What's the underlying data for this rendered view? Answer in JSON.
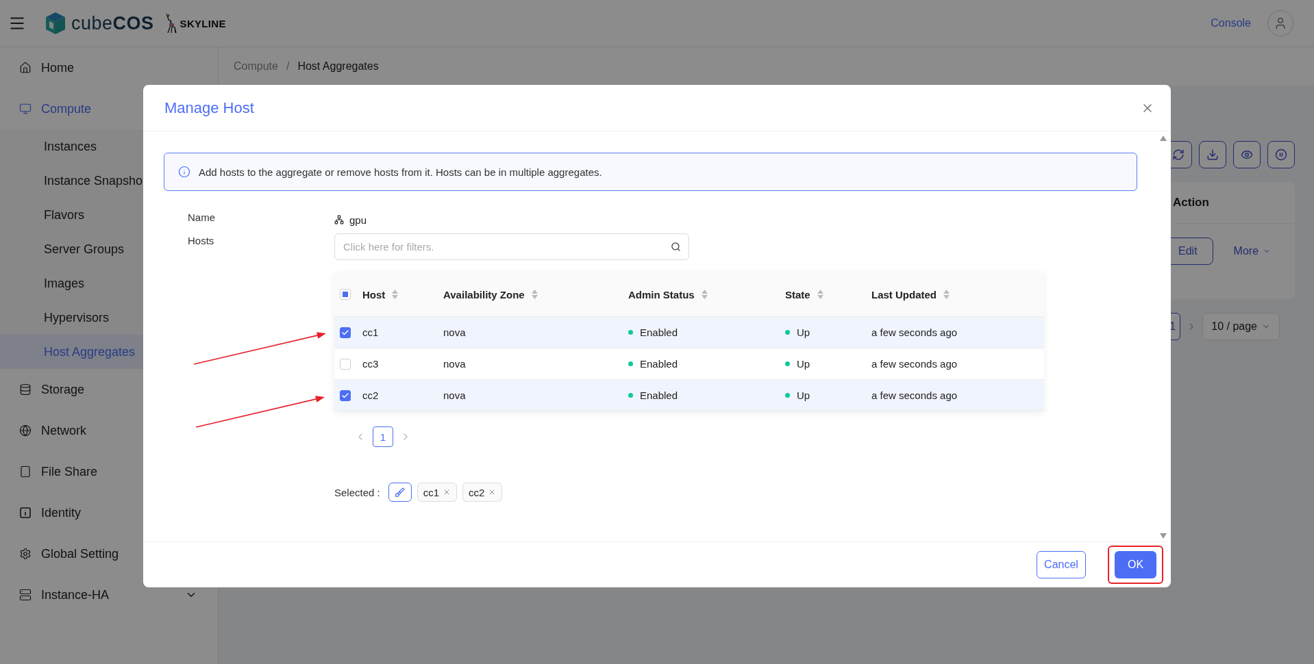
{
  "header": {
    "brand": {
      "light": "cube",
      "bold": "COS"
    },
    "partner_logo": "SKYLINE",
    "console_link": "Console"
  },
  "sidebar": {
    "items": [
      {
        "label": "Home",
        "selected": false
      },
      {
        "label": "Compute",
        "selected": true,
        "expanded": true,
        "children": [
          {
            "label": "Instances",
            "selected": false
          },
          {
            "label": "Instance Snapsho",
            "selected": false
          },
          {
            "label": "Flavors",
            "selected": false
          },
          {
            "label": "Server Groups",
            "selected": false
          },
          {
            "label": "Images",
            "selected": false
          },
          {
            "label": "Hypervisors",
            "selected": false
          },
          {
            "label": "Host Aggregates",
            "selected": true
          }
        ]
      },
      {
        "label": "Storage",
        "selected": false
      },
      {
        "label": "Network",
        "selected": false
      },
      {
        "label": "File Share",
        "selected": false
      },
      {
        "label": "Identity",
        "selected": false
      },
      {
        "label": "Global Setting",
        "selected": false
      },
      {
        "label": "Instance-HA",
        "selected": false,
        "expanded": false
      }
    ]
  },
  "breadcrumb": {
    "items": [
      "Compute",
      "Host Aggregates"
    ],
    "separator": "/"
  },
  "background_table": {
    "columns": [
      "Action"
    ],
    "row_actions": [
      "Edit",
      "More"
    ],
    "pagination": {
      "page": "1",
      "page_size": "10 / page"
    }
  },
  "modal": {
    "title": "Manage Host",
    "info": "Add hosts to the aggregate or remove hosts from it. Hosts can be in multiple aggregates.",
    "form": {
      "name_label": "Name",
      "name_value": "gpu",
      "hosts_label": "Hosts",
      "search": {
        "placeholder": "Click here for filters."
      }
    },
    "table": {
      "select_all": {
        "indeterminate": true
      },
      "columns": [
        "Host",
        "Availability Zone",
        "Admin Status",
        "State",
        "Last Updated"
      ],
      "rows": [
        {
          "host": "cc1",
          "zone": "nova",
          "admin_status": {
            "label": "Enabled",
            "color": "#10c99a"
          },
          "state": {
            "label": "Up",
            "color": "#10c99a"
          },
          "updated": "a few seconds ago",
          "selected": true
        },
        {
          "host": "cc3",
          "zone": "nova",
          "admin_status": {
            "label": "Enabled",
            "color": "#10c99a"
          },
          "state": {
            "label": "Up",
            "color": "#10c99a"
          },
          "updated": "a few seconds ago",
          "selected": false
        },
        {
          "host": "cc2",
          "zone": "nova",
          "admin_status": {
            "label": "Enabled",
            "color": "#10c99a"
          },
          "state": {
            "label": "Up",
            "color": "#10c99a"
          },
          "updated": "a few seconds ago",
          "selected": true
        }
      ],
      "pagination": {
        "pages": [
          {
            "label": "1",
            "selected": true
          }
        ]
      }
    },
    "selected_label": "Selected :",
    "selected_tags": [
      "cc1",
      "cc2"
    ],
    "buttons": {
      "cancel": "Cancel",
      "ok": "OK"
    }
  }
}
